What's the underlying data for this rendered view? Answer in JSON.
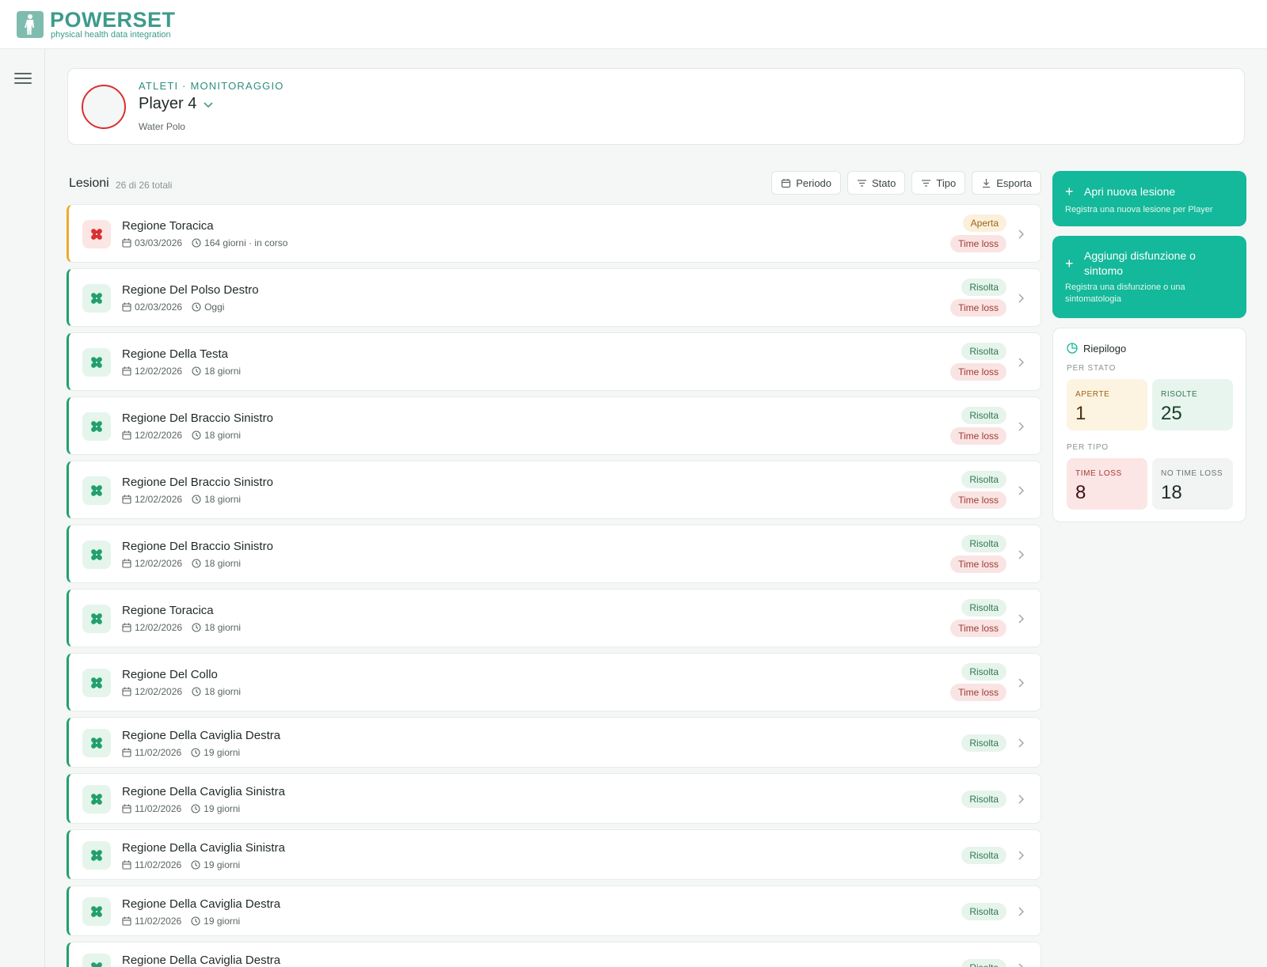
{
  "brand": {
    "title": "POWERSET",
    "subtitle": "physical health data integration"
  },
  "athlete": {
    "eyebrow": "ATLETI · MONITORAGGIO",
    "name": "Player 4",
    "sport": "Water Polo"
  },
  "list": {
    "title": "Lesioni",
    "count": "26 di 26 totali",
    "filters": [
      "Periodo",
      "Stato",
      "Tipo",
      "Esporta"
    ]
  },
  "injuries": [
    {
      "name": "Regione Toracica",
      "date": "03/03/2026",
      "duration": "164 giorni · in corso",
      "status": "Aperta",
      "time_loss": "Time loss",
      "open": true
    },
    {
      "name": "Regione Del Polso Destro",
      "date": "02/03/2026",
      "duration": "Oggi",
      "status": "Risolta",
      "time_loss": "Time loss"
    },
    {
      "name": "Regione Della Testa",
      "date": "12/02/2026",
      "duration": "18 giorni",
      "status": "Risolta",
      "time_loss": "Time loss"
    },
    {
      "name": "Regione Del Braccio Sinistro",
      "date": "12/02/2026",
      "duration": "18 giorni",
      "status": "Risolta",
      "time_loss": "Time loss"
    },
    {
      "name": "Regione Del Braccio Sinistro",
      "date": "12/02/2026",
      "duration": "18 giorni",
      "status": "Risolta",
      "time_loss": "Time loss"
    },
    {
      "name": "Regione Del Braccio Sinistro",
      "date": "12/02/2026",
      "duration": "18 giorni",
      "status": "Risolta",
      "time_loss": "Time loss"
    },
    {
      "name": "Regione Toracica",
      "date": "12/02/2026",
      "duration": "18 giorni",
      "status": "Risolta",
      "time_loss": "Time loss"
    },
    {
      "name": "Regione Del Collo",
      "date": "12/02/2026",
      "duration": "18 giorni",
      "status": "Risolta",
      "time_loss": "Time loss"
    },
    {
      "name": "Regione Della Caviglia Destra",
      "date": "11/02/2026",
      "duration": "19 giorni",
      "status": "Risolta",
      "time_loss": ""
    },
    {
      "name": "Regione Della Caviglia Sinistra",
      "date": "11/02/2026",
      "duration": "19 giorni",
      "status": "Risolta",
      "time_loss": ""
    },
    {
      "name": "Regione Della Caviglia Sinistra",
      "date": "11/02/2026",
      "duration": "19 giorni",
      "status": "Risolta",
      "time_loss": ""
    },
    {
      "name": "Regione Della Caviglia Destra",
      "date": "11/02/2026",
      "duration": "19 giorni",
      "status": "Risolta",
      "time_loss": ""
    },
    {
      "name": "Regione Della Caviglia Destra",
      "date": "",
      "duration": "",
      "status": "Risolta",
      "time_loss": ""
    }
  ],
  "actions": {
    "new_injury": {
      "title": "Apri nuova lesione",
      "desc": "Registra una nuova lesione per Player"
    },
    "new_dysfunction": {
      "title": "Aggiungi disfunzione o sintomo",
      "desc": "Registra una disfunzione o una sintomatologia"
    }
  },
  "summary": {
    "title": "Riepilogo",
    "by_status_label": "PER STATO",
    "by_type_label": "PER TIPO",
    "open_label": "APERTE",
    "open_value": "1",
    "resolved_label": "RISOLTE",
    "resolved_value": "25",
    "tl_label": "TIME LOSS",
    "tl_value": "8",
    "ntl_label": "NO TIME LOSS",
    "ntl_value": "18"
  },
  "colors": {
    "accent": "#14b89a",
    "brand": "#3d9b8c",
    "resolved": "#22a06b",
    "open": "#f0a92a",
    "alert": "#d93030"
  }
}
